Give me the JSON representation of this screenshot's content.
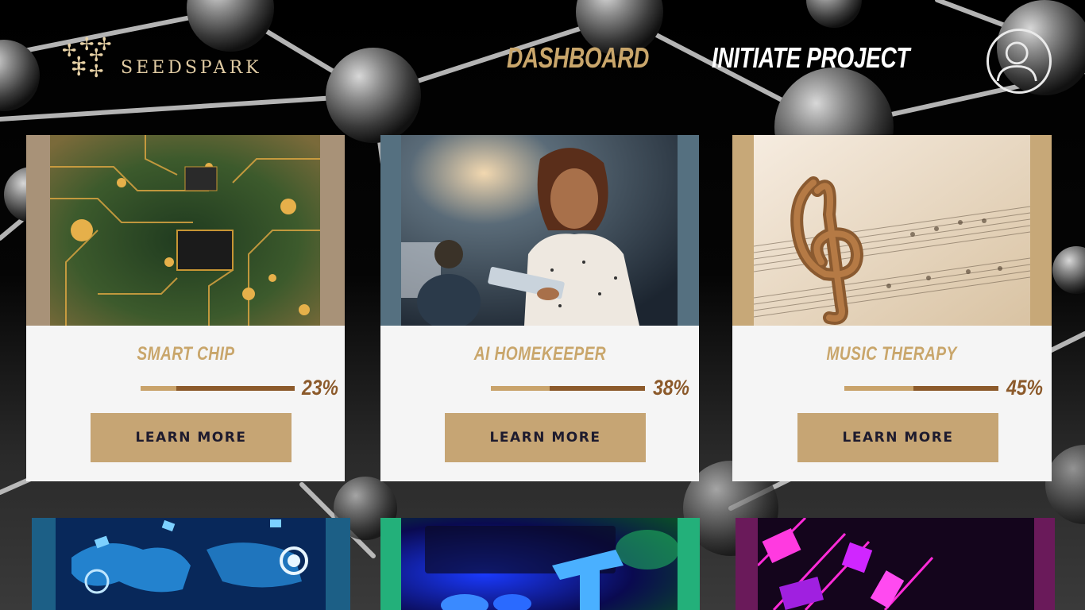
{
  "brand": {
    "name": "SEEDSPARK",
    "mark_glyph": "✢"
  },
  "nav": {
    "dashboard": "DASHBOARD",
    "initiate": "INITIATE PROJECT",
    "avatar_icon": "user-icon"
  },
  "colors": {
    "accent_gold": "#c9a66b",
    "progress_dark": "#8c5a2b",
    "button_bg": "#c6a574",
    "button_text": "#1e1b2e",
    "card_bg": "#f5f5f5"
  },
  "projects": [
    {
      "title": "SMART CHIP",
      "progress_label": "23%",
      "progress": 0.23,
      "button": "LEARN MORE",
      "image": "circuit-board-image"
    },
    {
      "title": "AI HOMEKEEPER",
      "progress_label": "38%",
      "progress": 0.38,
      "button": "LEARN MORE",
      "image": "woman-with-tablet-image"
    },
    {
      "title": "MUSIC THERAPY",
      "progress_label": "45%",
      "progress": 0.45,
      "button": "LEARN MORE",
      "image": "treble-clef-sheet-music-image"
    }
  ],
  "partial_projects": [
    {
      "image": "world-map-network-image"
    },
    {
      "image": "neon-keyboard-image"
    },
    {
      "image": "neon-pink-cubes-image"
    }
  ]
}
